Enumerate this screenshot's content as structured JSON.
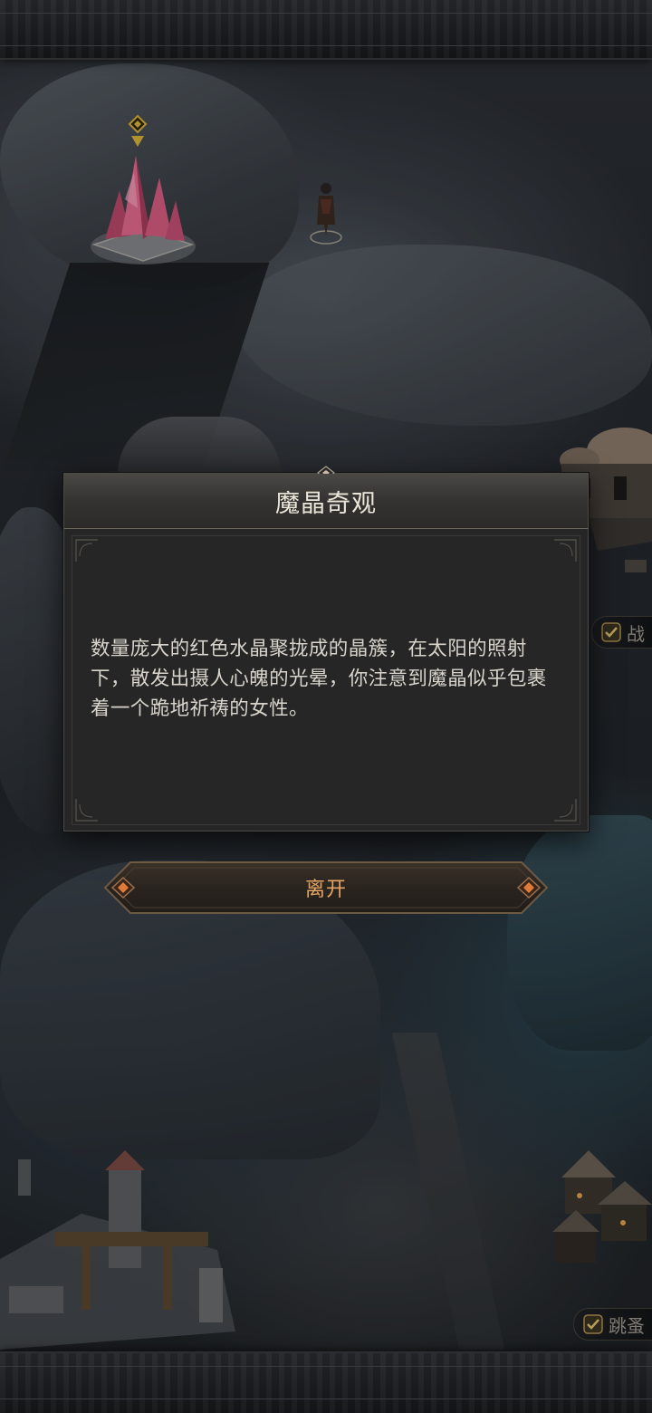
{
  "dialog": {
    "title": "魔晶奇观",
    "description": "数量庞大的红色水晶聚拢成的晶簇，在太阳的照射下，散发出摄人心魄的光晕，你注意到魔晶似乎包裹着一个跪地祈祷的女性。",
    "leave_label": "离开"
  },
  "side_tasks": [
    {
      "label": "战",
      "checked": true
    },
    {
      "label": "跳蚤",
      "checked": true
    }
  ],
  "map": {
    "landmark_icon": "pink-crystal-icon",
    "marker_icon": "quest-location-marker-icon"
  },
  "colors": {
    "dialog_bg": "#262626",
    "title_text": "#ece6d9",
    "body_text": "#d8d4cc",
    "button_text": "#e4a463",
    "accent_gem": "#e07a3a",
    "marker_gold": "#d7b13a",
    "crystal_pink": "#e16a8e"
  }
}
